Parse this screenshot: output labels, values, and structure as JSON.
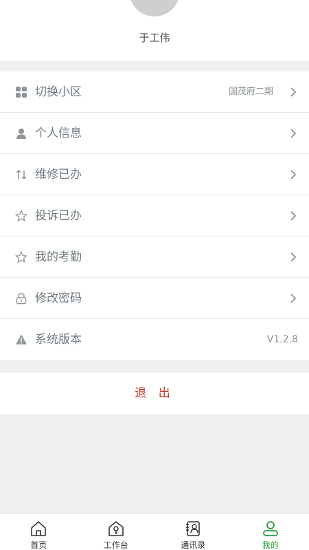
{
  "profile": {
    "name": "于工伟"
  },
  "menu": {
    "items": [
      {
        "icon": "grid-icon",
        "label": "切换小区",
        "value": "国茂府二期"
      },
      {
        "icon": "person-icon",
        "label": "个人信息"
      },
      {
        "icon": "sort-arrows-icon",
        "label": "维修已办"
      },
      {
        "icon": "star-icon",
        "label": "投诉已办"
      },
      {
        "icon": "star-icon",
        "label": "我的考勤"
      },
      {
        "icon": "lock-icon",
        "label": "修改密码"
      },
      {
        "icon": "warning-icon",
        "label": "系统版本",
        "value": "V1.2.8"
      }
    ]
  },
  "logout": {
    "label": "退 出"
  },
  "tabbar": {
    "tabs": [
      {
        "icon": "home-icon",
        "label": "首页",
        "active": false
      },
      {
        "icon": "workbench-icon",
        "label": "工作台",
        "active": false
      },
      {
        "icon": "contacts-icon",
        "label": "通讯录",
        "active": false
      },
      {
        "icon": "user-icon",
        "label": "我的",
        "active": true
      }
    ]
  },
  "colors": {
    "accent": "#2a9d3a",
    "logout": "#c0392b",
    "icon": "#9aa0a3",
    "background": "#f0f0f0"
  }
}
